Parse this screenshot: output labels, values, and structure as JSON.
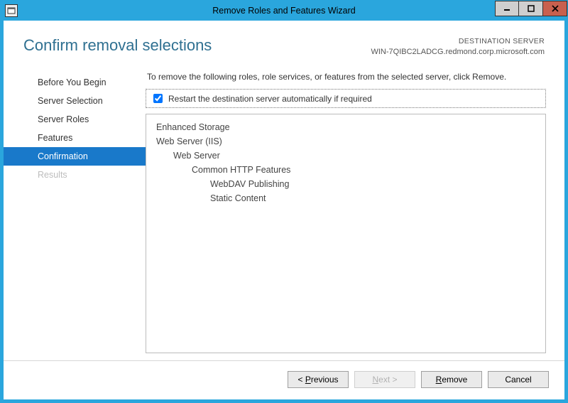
{
  "titlebar": {
    "title": "Remove Roles and Features Wizard"
  },
  "header": {
    "page_title": "Confirm removal selections",
    "dest_label": "DESTINATION SERVER",
    "dest_server": "WIN-7QIBC2LADCG.redmond.corp.microsoft.com"
  },
  "nav": {
    "items": [
      {
        "label": "Before You Begin"
      },
      {
        "label": "Server Selection"
      },
      {
        "label": "Server Roles"
      },
      {
        "label": "Features"
      },
      {
        "label": "Confirmation",
        "selected": true
      },
      {
        "label": "Results",
        "disabled": true
      }
    ]
  },
  "main": {
    "instruction": "To remove the following roles, role services, or features from the selected server, click Remove.",
    "restart_label": "Restart the destination server automatically if required",
    "restart_checked": true,
    "tree": [
      {
        "level": 0,
        "label": "Enhanced Storage"
      },
      {
        "level": 0,
        "label": "Web Server (IIS)"
      },
      {
        "level": 1,
        "label": "Web Server"
      },
      {
        "level": 2,
        "label": "Common HTTP Features"
      },
      {
        "level": 3,
        "label": "WebDAV Publishing"
      },
      {
        "level": 3,
        "label": "Static Content"
      }
    ]
  },
  "footer": {
    "previous": "< Previous",
    "next": "Next >",
    "remove": "Remove",
    "cancel": "Cancel"
  }
}
